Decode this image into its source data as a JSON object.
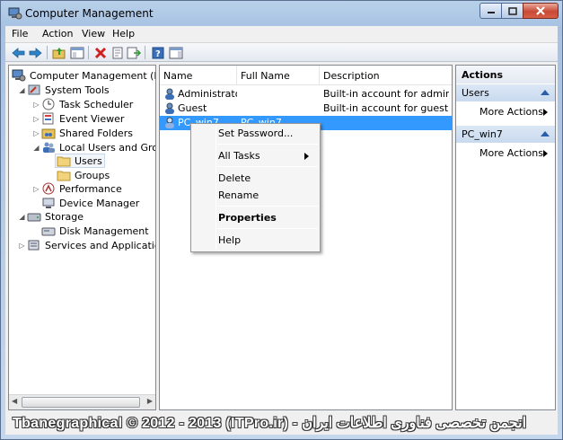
{
  "window": {
    "title": "Computer Management",
    "icon": "computer-management-icon"
  },
  "menubar": {
    "items": [
      "File",
      "Action",
      "View",
      "Help"
    ]
  },
  "toolbar": {
    "icons": [
      "back-arrow-icon",
      "forward-arrow-icon",
      "up-folder-icon",
      "show-hide-tree-icon",
      "delete-icon",
      "properties-icon",
      "export-list-icon",
      "help-icon",
      "show-hide-action-pane-icon"
    ]
  },
  "tree": {
    "nodes": [
      {
        "label": "Computer Management (Local",
        "icon": "computer-management-icon"
      },
      {
        "label": "System Tools",
        "icon": "tools-icon"
      },
      {
        "label": "Task Scheduler",
        "icon": "clock-icon"
      },
      {
        "label": "Event Viewer",
        "icon": "event-viewer-icon"
      },
      {
        "label": "Shared Folders",
        "icon": "shared-folder-icon"
      },
      {
        "label": "Local Users and Groups",
        "icon": "users-group-icon"
      },
      {
        "label": "Users",
        "icon": "folder-icon"
      },
      {
        "label": "Groups",
        "icon": "folder-icon"
      },
      {
        "label": "Performance",
        "icon": "performance-icon"
      },
      {
        "label": "Device Manager",
        "icon": "device-manager-icon"
      },
      {
        "label": "Storage",
        "icon": "storage-icon"
      },
      {
        "label": "Disk Management",
        "icon": "disk-icon"
      },
      {
        "label": "Services and Applications",
        "icon": "services-icon"
      }
    ]
  },
  "list": {
    "columns": [
      "Name",
      "Full Name",
      "Description"
    ],
    "rows": [
      {
        "name": "Administrator",
        "full_name": "",
        "description": "Built-in account for adminis..."
      },
      {
        "name": "Guest",
        "full_name": "",
        "description": "Built-in account for guest ac..."
      },
      {
        "name": "PC_win7",
        "full_name": "PC_win7",
        "description": ""
      }
    ]
  },
  "actions": {
    "header": "Actions",
    "sections": [
      {
        "title": "Users",
        "item": "More Actions"
      },
      {
        "title": "PC_win7",
        "item": "More Actions"
      }
    ]
  },
  "context_menu": {
    "items": [
      "Set Password...",
      "All Tasks",
      "Delete",
      "Rename",
      "Properties",
      "Help"
    ]
  },
  "watermark": "Tbanegraphical © 2012 - 2013 (ITPro.ir) - انجمن تخصصی فناوری اطلاعات ایران"
}
